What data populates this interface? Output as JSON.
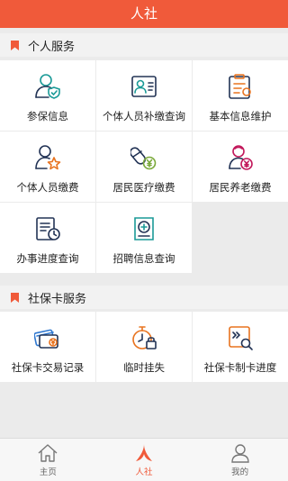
{
  "header": {
    "title": "人社"
  },
  "section1": {
    "title": "个人服务",
    "items": [
      {
        "label": "参保信息",
        "icon": "user-shield-icon"
      },
      {
        "label": "个体人员补缴查询",
        "icon": "id-card-icon"
      },
      {
        "label": "基本信息维护",
        "icon": "clipboard-edit-icon"
      },
      {
        "label": "个体人员缴费",
        "icon": "user-star-icon"
      },
      {
        "label": "居民医疗缴费",
        "icon": "pill-yen-icon"
      },
      {
        "label": "居民养老缴费",
        "icon": "elder-yen-icon"
      },
      {
        "label": "办事进度查询",
        "icon": "document-clock-icon"
      },
      {
        "label": "招聘信息查询",
        "icon": "document-search-icon"
      }
    ]
  },
  "section2": {
    "title": "社保卡服务",
    "items": [
      {
        "label": "社保卡交易记录",
        "icon": "card-yen-icon"
      },
      {
        "label": "临时挂失",
        "icon": "stopwatch-lock-icon"
      },
      {
        "label": "社保卡制卡进度",
        "icon": "card-progress-icon"
      }
    ]
  },
  "tabbar": {
    "items": [
      {
        "label": "主页",
        "active": false
      },
      {
        "label": "人社",
        "active": true
      },
      {
        "label": "我的",
        "active": false
      }
    ]
  },
  "colors": {
    "accent": "#f05a3a",
    "teal": "#1a9a97",
    "navy": "#223355",
    "orange": "#e8731f",
    "green": "#7aa93a",
    "magenta": "#c2185b",
    "blue": "#2f78d0"
  }
}
